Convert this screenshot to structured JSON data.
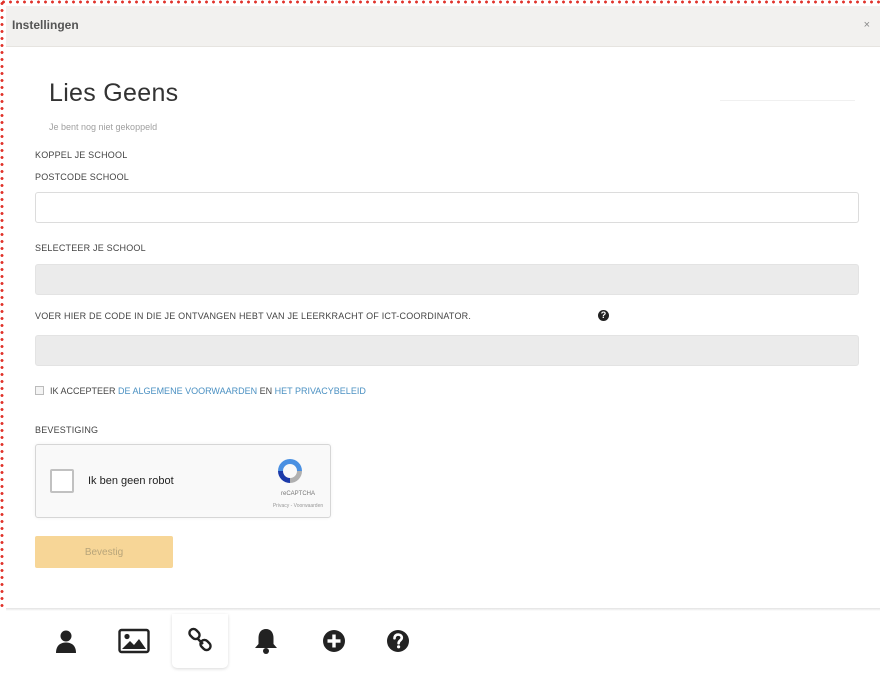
{
  "window": {
    "title": "Instellingen",
    "close_label": "×"
  },
  "profile": {
    "name": "Lies Geens",
    "status": "Je bent nog niet gekoppeld"
  },
  "form": {
    "section_title": "KOPPEL JE SCHOOL",
    "postcode_label": "POSTCODE SCHOOL",
    "postcode_value": "",
    "school_label": "SELECTEER JE SCHOOL",
    "code_label": "VOER HIER DE CODE IN DIE JE ONTVANGEN HEBT VAN JE LEERKRACHT OF ICT-COORDINATOR.",
    "accept_prefix": "IK ACCEPTEER",
    "accept_terms_link": "DE ALGEMENE VOORWAARDEN",
    "accept_middle": "EN",
    "accept_privacy_link": "HET PRIVACYBELEID",
    "confirmation_label": "BEVESTIGING",
    "submit_label": "Bevestig"
  },
  "captcha": {
    "label": "Ik ben geen robot",
    "brand": "reCAPTCHA",
    "links": "Privacy - Voorwaarden"
  },
  "tabs": [
    {
      "icon": "user-icon",
      "active": false
    },
    {
      "icon": "image-icon",
      "active": false
    },
    {
      "icon": "link-icon",
      "active": true
    },
    {
      "icon": "bell-icon",
      "active": false
    },
    {
      "icon": "plus-circle-icon",
      "active": false
    },
    {
      "icon": "question-circle-icon",
      "active": false
    }
  ],
  "colors": {
    "accent_link": "#4a90c2",
    "submit_button": "#f7d697",
    "frame_dots": "#e0332b"
  }
}
